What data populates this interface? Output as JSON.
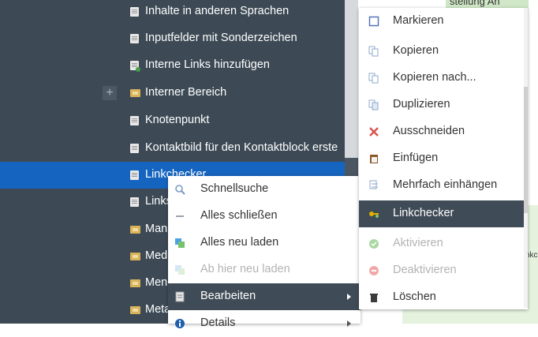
{
  "tree": {
    "items": [
      {
        "label": "Inhalte in anderen Sprachen",
        "icon": "document-icon"
      },
      {
        "label": "Inputfelder mit Sonderzeichen",
        "icon": "document-icon"
      },
      {
        "label": "Interne Links hinzufügen",
        "icon": "document-icon"
      },
      {
        "label": "Interner Bereich",
        "icon": "folder-icon",
        "expand": "+"
      },
      {
        "label": "Knotenpunkt",
        "icon": "document-icon"
      },
      {
        "label": "Kontaktbild für den Kontaktblock erste",
        "icon": "document-icon"
      },
      {
        "label": "Linkchecker",
        "icon": "document-icon",
        "selected": true
      },
      {
        "label": "Links",
        "icon": "document-icon"
      },
      {
        "label": "Man",
        "icon": "folder-icon"
      },
      {
        "label": "Med",
        "icon": "folder-icon"
      },
      {
        "label": "Men",
        "icon": "folder-icon"
      },
      {
        "label": "Meta",
        "icon": "folder-icon"
      }
    ]
  },
  "right_panel": {
    "header_text": "stellung An",
    "side_text": "nkc"
  },
  "context_menu": {
    "items": [
      {
        "label": "Schnellsuche",
        "icon": "magnifier-icon"
      },
      {
        "label": "Alles schließen",
        "icon": "collapse-icon"
      },
      {
        "label": "Alles neu laden",
        "icon": "reload-icon"
      },
      {
        "label": "Ab hier neu laden",
        "icon": "reload-here-icon",
        "disabled": true
      },
      {
        "label": "Bearbeiten",
        "icon": "edit-icon",
        "active": true,
        "submenu": true
      },
      {
        "label": "Details",
        "icon": "info-icon",
        "submenu": true
      }
    ]
  },
  "edit_submenu": {
    "items": [
      {
        "label": "Markieren",
        "icon": "select-icon"
      },
      {
        "label": "Kopieren",
        "icon": "copy-icon"
      },
      {
        "label": "Kopieren nach...",
        "icon": "copy-to-icon"
      },
      {
        "label": "Duplizieren",
        "icon": "duplicate-icon"
      },
      {
        "label": "Ausschneiden",
        "icon": "cut-icon"
      },
      {
        "label": "Einfügen",
        "icon": "paste-icon"
      },
      {
        "label": "Mehrfach einhängen",
        "icon": "multi-attach-icon"
      },
      {
        "label": "Linkchecker",
        "icon": "linkchecker-icon",
        "active": true
      },
      {
        "label": "Aktivieren",
        "icon": "activate-icon",
        "disabled": true
      },
      {
        "label": "Deaktivieren",
        "icon": "deactivate-icon",
        "disabled": true
      },
      {
        "label": "Löschen",
        "icon": "trash-icon"
      }
    ]
  },
  "colors": {
    "tree_bg": "#3d4a55",
    "selected_row": "#1565c0",
    "menu_active": "#3f4b56",
    "accent_green": "#43a047"
  }
}
